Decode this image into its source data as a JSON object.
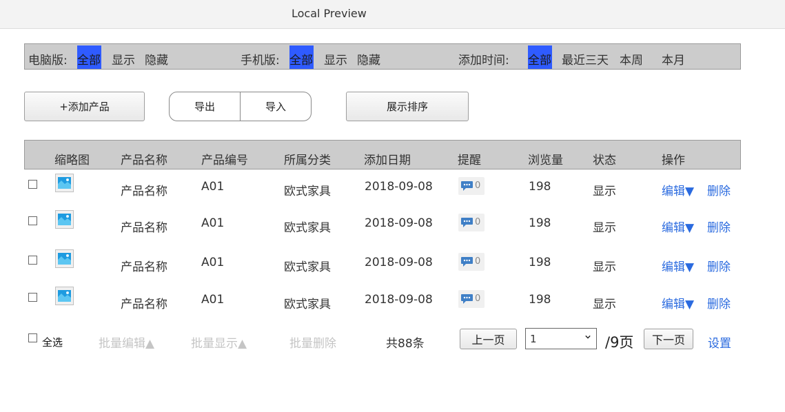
{
  "window": {
    "title": "Local Preview"
  },
  "filters": {
    "pc": {
      "label": "电脑版:",
      "options": [
        "全部",
        "显示",
        "隐藏"
      ],
      "selected": "全部"
    },
    "mobile": {
      "label": "手机版:",
      "options": [
        "全部",
        "显示",
        "隐藏"
      ],
      "selected": "全部"
    },
    "time": {
      "label": "添加时间:",
      "options": [
        "全部",
        "最近三天",
        "本周",
        "本月"
      ],
      "selected": "全部"
    }
  },
  "toolbar": {
    "add_label": "+添加产品",
    "export_label": "导出",
    "import_label": "导入",
    "sort_label": "展示排序"
  },
  "table": {
    "headers": [
      "缩略图",
      "产品名称",
      "产品编号",
      "所属分类",
      "添加日期",
      "提醒",
      "浏览量",
      "状态",
      "操作"
    ],
    "rows": [
      {
        "name": "产品名称",
        "code": "A01",
        "category": "欧式家具",
        "date": "2018-09-08",
        "reminders": "0",
        "views": "198",
        "status": "显示",
        "edit": "编辑▼",
        "delete": "删除"
      },
      {
        "name": "产品名称",
        "code": "A01",
        "category": "欧式家具",
        "date": "2018-09-08",
        "reminders": "0",
        "views": "198",
        "status": "显示",
        "edit": "编辑▼",
        "delete": "删除"
      },
      {
        "name": "产品名称",
        "code": "A01",
        "category": "欧式家具",
        "date": "2018-09-08",
        "reminders": "0",
        "views": "198",
        "status": "显示",
        "edit": "编辑▼",
        "delete": "删除"
      },
      {
        "name": "产品名称",
        "code": "A01",
        "category": "欧式家具",
        "date": "2018-09-08",
        "reminders": "0",
        "views": "198",
        "status": "显示",
        "edit": "编辑▼",
        "delete": "删除"
      }
    ]
  },
  "footer": {
    "select_all": "全选",
    "batch_edit": "批量编辑▲",
    "batch_show": "批量显示▲",
    "batch_delete": "批量删除",
    "total": "共88条",
    "prev": "上一页",
    "page_value": "1",
    "pages_total": "/9页",
    "next": "下一页",
    "settings": "设置"
  },
  "colors": {
    "selected_bg": "#2f5bff",
    "link": "#2a6adf",
    "header_bg": "#cccccc",
    "disabled_text": "#c5c5c5"
  },
  "icons": {
    "thumbnail": "image-icon",
    "reminder": "chat-bubble-icon",
    "dropdown": "chevron-down-icon"
  }
}
